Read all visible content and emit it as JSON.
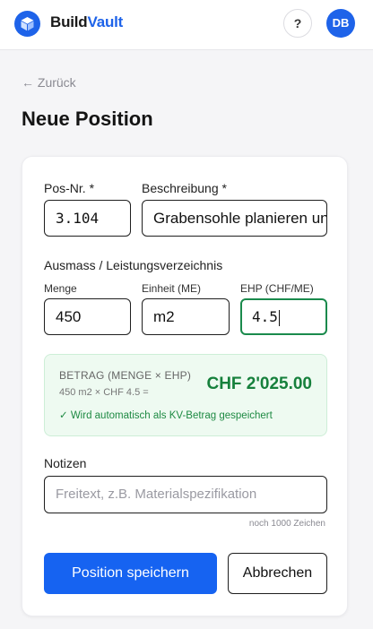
{
  "header": {
    "brand_part1": "Build",
    "brand_part2": "Vault",
    "help_label": "?",
    "avatar_initials": "DB",
    "logo_icon": "cube-icon",
    "accent_color": "#1e63e9"
  },
  "nav": {
    "back_label": "← Zurück"
  },
  "page": {
    "title": "Neue Position"
  },
  "form": {
    "posnr_label": "Pos-Nr. *",
    "posnr_value": "3.104",
    "beschreibung_label": "Beschreibung *",
    "beschreibung_value": "Grabensohle planieren und verdichten",
    "section_label": "Ausmass / Leistungsverzeichnis",
    "menge_label": "Menge",
    "menge_value": "450",
    "einheit_label": "Einheit (ME)",
    "einheit_value": "m2",
    "ehp_label": "EHP (CHF/ME)",
    "ehp_value": "4.5",
    "betrag": {
      "label": "BETRAG (MENGE × EHP)",
      "formula": "450 m2 × CHF 4.5 =",
      "amount": "CHF 2'025.00",
      "note": "✓ Wird automatisch als KV-Betrag gespeichert",
      "accent_color": "#16803c"
    },
    "notizen_label": "Notizen",
    "notizen_placeholder": "Freitext, z.B. Materialspezifikation",
    "char_count": "noch 1000 Zeichen",
    "save_label": "Position speichern",
    "cancel_label": "Abbrechen"
  }
}
